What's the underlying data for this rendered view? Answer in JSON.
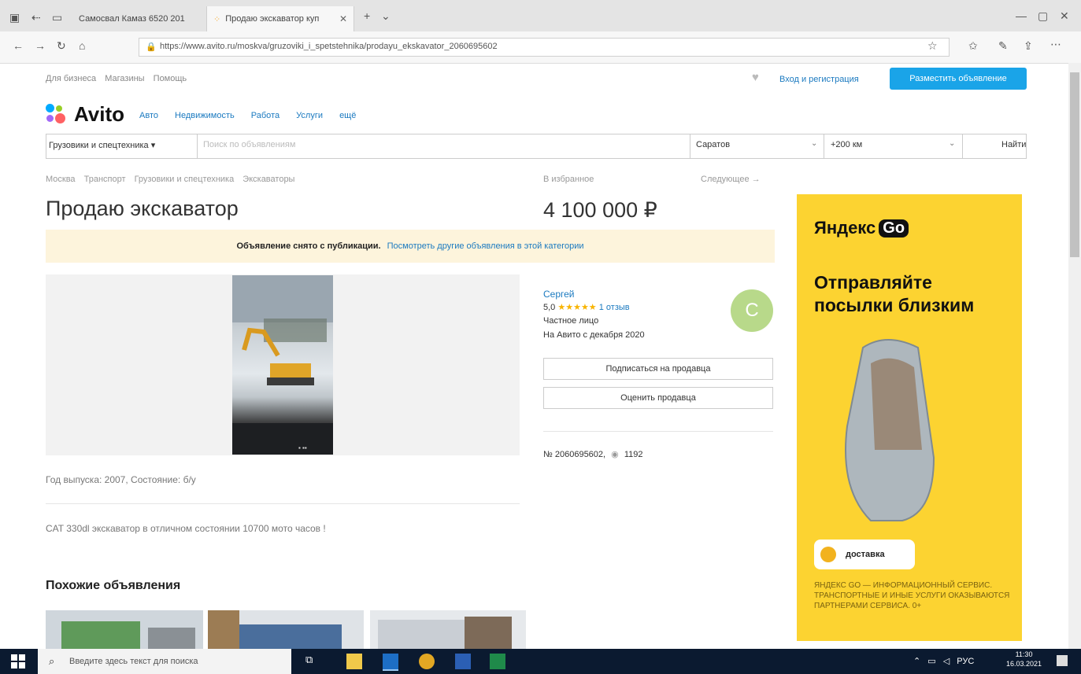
{
  "browser": {
    "tab_inactive": "Самосвал Камаз 6520 201",
    "tab_active": "Продаю экскаватор куп",
    "url": "https://www.avito.ru/moskva/gruzoviki_i_spetstehnika/prodayu_ekskavator_2060695602"
  },
  "header": {
    "links": [
      "Для бизнеса",
      "Магазины",
      "Помощь"
    ],
    "login": "Вход и регистрация",
    "post_button": "Разместить объявление",
    "logo": "Avito",
    "nav": [
      "Авто",
      "Недвижимость",
      "Работа",
      "Услуги",
      "ещё"
    ]
  },
  "search": {
    "category": "Грузовики и спецтехника",
    "placeholder": "Поиск по объявлениям",
    "city": "Саратов",
    "radius": "+200 км",
    "button": "Найти"
  },
  "listing": {
    "breadcrumbs": [
      "Москва",
      "Транспорт",
      "Грузовики и спецтехника",
      "Экскаваторы"
    ],
    "favorites": "В избранное",
    "next": "Следующее →",
    "title": "Продаю экскаватор",
    "price": "4 100 000 ₽",
    "notice_bold": "Объявление снято с публикации.",
    "notice_link": "Посмотреть другие объявления в этой категории",
    "params": "Год выпуска: 2007, Состояние: б/у",
    "description": "CAT 330dl экскаватор в отличном состоянии 10700 мото часов !",
    "ad_id": "№ 2060695602,",
    "views": "1192"
  },
  "seller": {
    "name": "Сергей",
    "rating": "5,0",
    "stars": "★★★★★",
    "reviews": "1 отзыв",
    "type": "Частное лицо",
    "since": "На Авито с декабря 2020",
    "avatar_letter": "С",
    "subscribe": "Подписаться на продавца",
    "rate": "Оценить продавца"
  },
  "similar": {
    "title": "Похожие объявления"
  },
  "ad": {
    "brand": "Яндекс",
    "go": "Go",
    "headline": "Отправляйте посылки близким",
    "delivery": "доставка",
    "disclaimer": "Яндекс Go — информационный сервис. Транспортные и иные услуги оказываются партнерами сервиса. 0+"
  },
  "taskbar": {
    "search_placeholder": "Введите здесь текст для поиска",
    "lang": "РУС",
    "time": "11:30",
    "date": "16.03.2021"
  },
  "colors": {
    "accent": "#1aa4e8",
    "link": "#1b7ac0",
    "ad_bg": "#fcd331",
    "notice_bg": "#fdf4dc"
  }
}
